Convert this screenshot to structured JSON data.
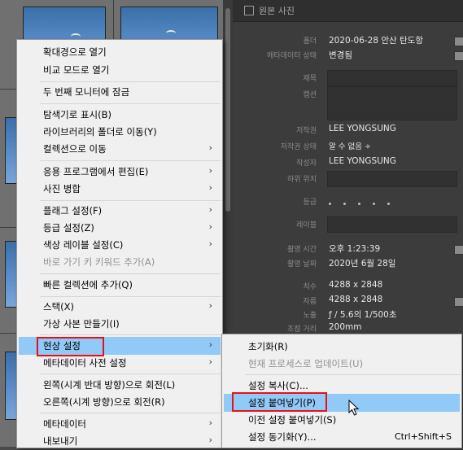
{
  "metadata_panel": {
    "header": "원본 사진",
    "rows": {
      "folder": {
        "label": "폴더",
        "value": "2020-06-28 안산 탄도항"
      },
      "metadata_status": {
        "label": "메타데이터 상태",
        "value": "변경됨"
      },
      "title": {
        "label": "제목"
      },
      "caption": {
        "label": "캡션"
      },
      "copyright": {
        "label": "저작권",
        "value": "LEE YONGSUNG"
      },
      "copyright_status": {
        "label": "저작권 상태",
        "value": "알 수 없음 ÷"
      },
      "creator": {
        "label": "작성자",
        "value": "LEE YONGSUNG"
      },
      "sublocation": {
        "label": "하위 위치"
      },
      "rating": {
        "label": "등급"
      },
      "color_label": {
        "label": "레이블"
      },
      "capture_time": {
        "label": "촬영 시간",
        "value": "오후 1:23:39"
      },
      "capture_date": {
        "label": "촬영 날짜",
        "value": "2020년 6월 28일"
      },
      "dimensions": {
        "label": "치수",
        "value": "4288 x 2848"
      },
      "cropped": {
        "label": "자름",
        "value": "4288 x 2848"
      },
      "exposure": {
        "label": "노출",
        "value": "ƒ / 5.6의 1/500초"
      },
      "focal_length": {
        "label": "초점 거리",
        "value": "200mm"
      }
    }
  },
  "context_menu": {
    "items": [
      {
        "label": "확대경으로 열기"
      },
      {
        "label": "비교 모드로 열기"
      },
      {
        "label": "두 번째 모니터에 잠금"
      },
      {
        "label": "탐색기로 표시(B)"
      },
      {
        "label": "라이브러리의 폴더로 이동(Y)"
      },
      {
        "label": "컬렉션으로 이동",
        "arrow": "›"
      },
      {
        "label": "응용 프로그램에서 편집(E)",
        "arrow": "›"
      },
      {
        "label": "사진 병합",
        "arrow": "›"
      },
      {
        "label": "플래그 설정(F)",
        "arrow": "›"
      },
      {
        "label": "등급 설정(Z)",
        "arrow": "›"
      },
      {
        "label": "색상 레이블 설정(C)",
        "arrow": "›"
      },
      {
        "label": "바로 가기 키 키워드 추가(A)"
      },
      {
        "label": "빠른 컬렉션에 추가(Q)"
      },
      {
        "label": "스택(X)",
        "arrow": "›"
      },
      {
        "label": "가상 사본 만들기(I)"
      },
      {
        "label": "현상 설정",
        "arrow": "›"
      },
      {
        "label": "메타데이터 사전 설정",
        "arrow": "›"
      },
      {
        "label": "왼쪽(시계 반대 방향)으로 회전(L)"
      },
      {
        "label": "오른쪽(시계 방향)으로 회전(R)"
      },
      {
        "label": "메타데이터",
        "arrow": "›"
      },
      {
        "label": "내보내기",
        "arrow": "›"
      }
    ]
  },
  "submenu": {
    "items": [
      {
        "label": "초기화(R)"
      },
      {
        "label": "현재 프로세스로 업데이트(U)"
      },
      {
        "label": "설정 복사(C)..."
      },
      {
        "label": "설정 붙여넣기(P)"
      },
      {
        "label": "이전 설정 붙여넣기(S)"
      },
      {
        "label": "설정 동기화(Y)...",
        "shortcut": "Ctrl+Shift+S"
      }
    ]
  },
  "colors": {
    "highlight": "#91c9f7",
    "annotation_red": "#e8101a",
    "menu_bg": "#f0f0f0"
  }
}
